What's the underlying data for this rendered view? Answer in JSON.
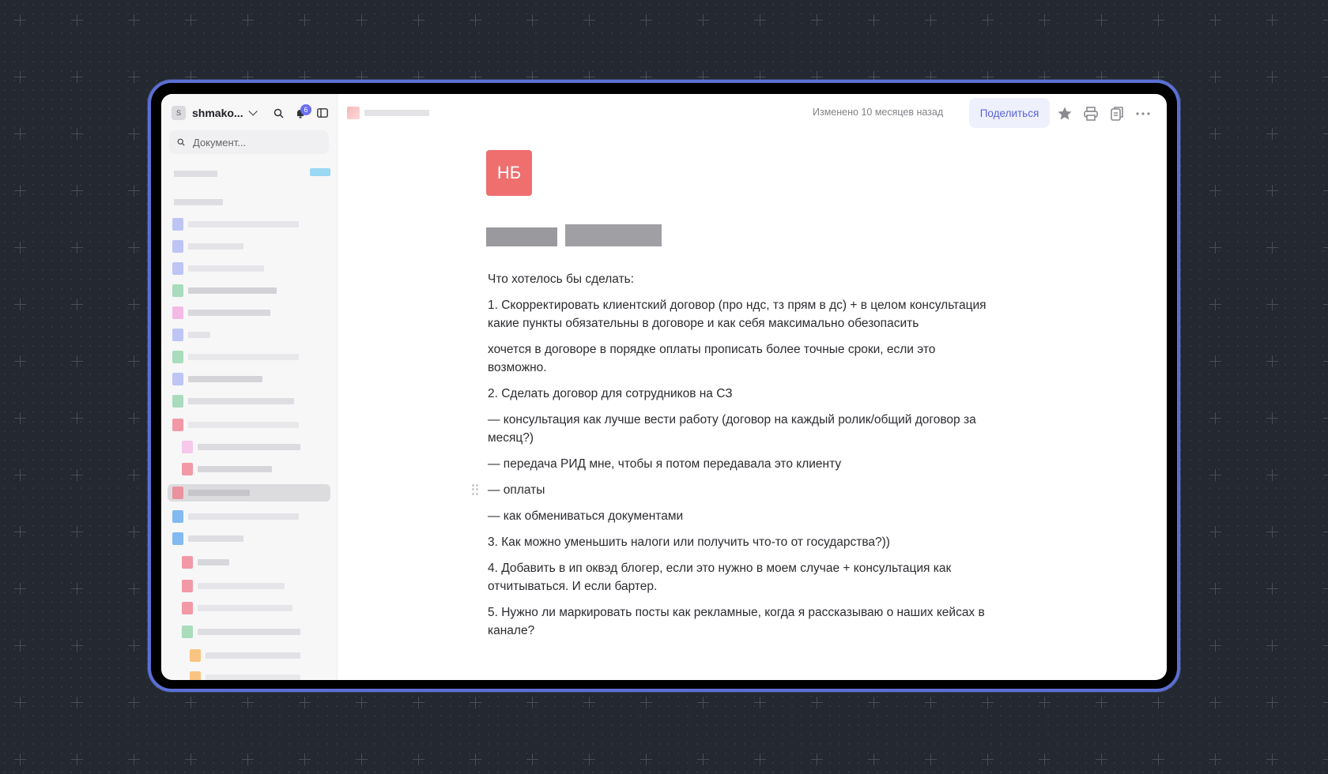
{
  "sidebar": {
    "workspace_initial": "S",
    "workspace_name": "shmako...",
    "notifications_count": "6",
    "search_placeholder": "Документ..."
  },
  "topbar": {
    "modified_text": "Изменено 10 месяцев назад",
    "share_label": "Поделиться"
  },
  "document": {
    "avatar_initials": "НБ",
    "paragraphs": [
      "Что хотелось бы сделать:",
      "1. Скорректировать клиентский договор (про ндс, тз прям в дс) + в целом консультация какие пункты обязательны в договоре и как себя максимально обезопасить",
      "хочется в договоре в порядке оплаты прописать более точные сроки, если это возможно.",
      "2. Сделать договор для сотрудников на СЗ",
      "— консультация как лучше вести работу (договор на каждый ролик/общий договор за месяц?)",
      "— передача РИД мне, чтобы я потом передавала это клиенту",
      "— оплаты",
      "— как обмениваться документами",
      "3. Как можно уменьшить налоги или получить что-то от государства?))",
      "4. Добавить в ип оквэд блогер, если это нужно в моем случае + консультация как отчитываться. И если бартер.",
      "5. Нужно ли маркировать посты как рекламные, когда я рассказываю о наших кейсах в канале?"
    ]
  },
  "colors": {
    "accent": "#5a63d6",
    "frame": "#5b6fd4",
    "doc_avatar": "#ef6e6e",
    "badge": "#6a6ff0"
  },
  "icons": [
    "search-icon",
    "bell-icon",
    "sidebar-toggle-icon",
    "star-icon",
    "print-icon",
    "copy-icon",
    "more-icon",
    "drag-handle-icon"
  ]
}
